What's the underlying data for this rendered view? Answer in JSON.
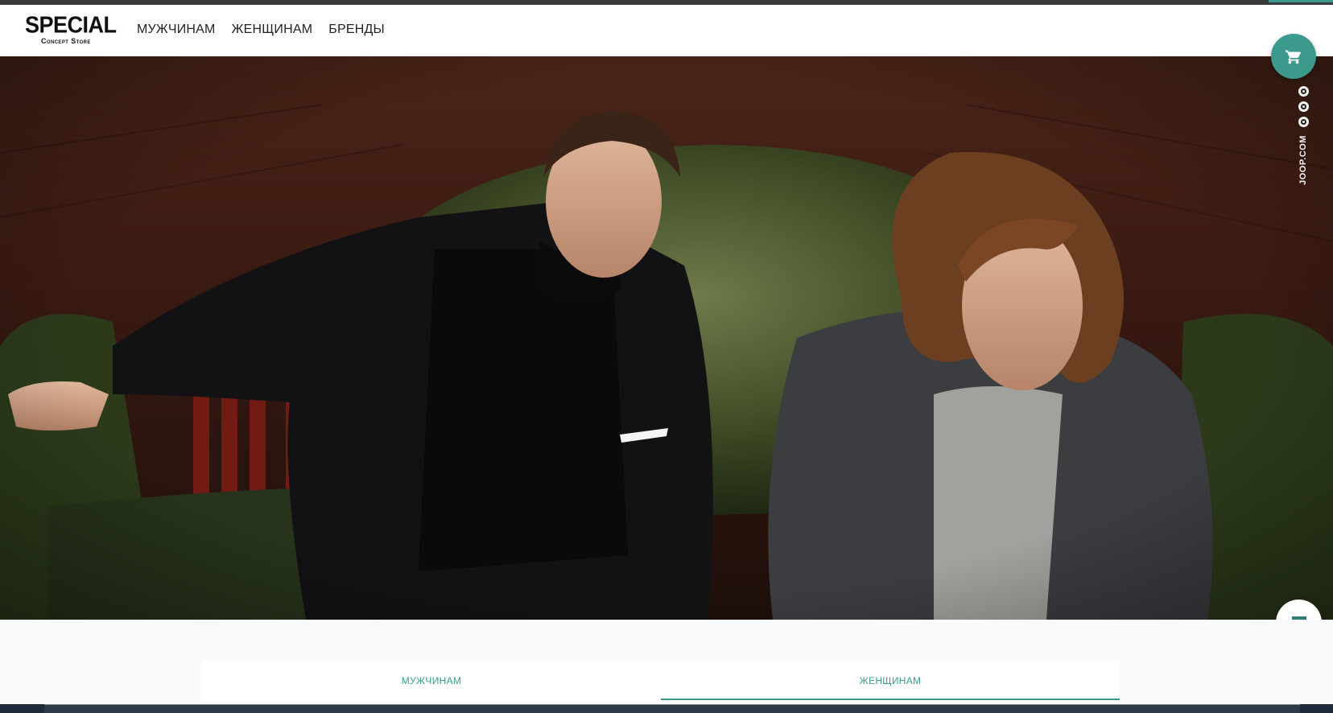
{
  "logo": {
    "line1": "SPECIAL",
    "line2": "Concept Store"
  },
  "nav": {
    "items": [
      {
        "label": "МУЖЧИНАМ"
      },
      {
        "label": "ЖЕНЩИНАМ"
      },
      {
        "label": "БРЕНДЫ"
      }
    ]
  },
  "hero": {
    "brand_vertical": "JOOP.COM"
  },
  "tabs": [
    {
      "label": "МУЖЧИНАМ",
      "active": false
    },
    {
      "label": "ЖЕНЩИНАМ",
      "active": true
    }
  ],
  "colors": {
    "accent": "#3c9a8d"
  },
  "icons": {
    "cart": "cart-icon",
    "chat": "chat-icon",
    "social": [
      "vk-icon",
      "ok-icon",
      "instagram-icon"
    ]
  }
}
